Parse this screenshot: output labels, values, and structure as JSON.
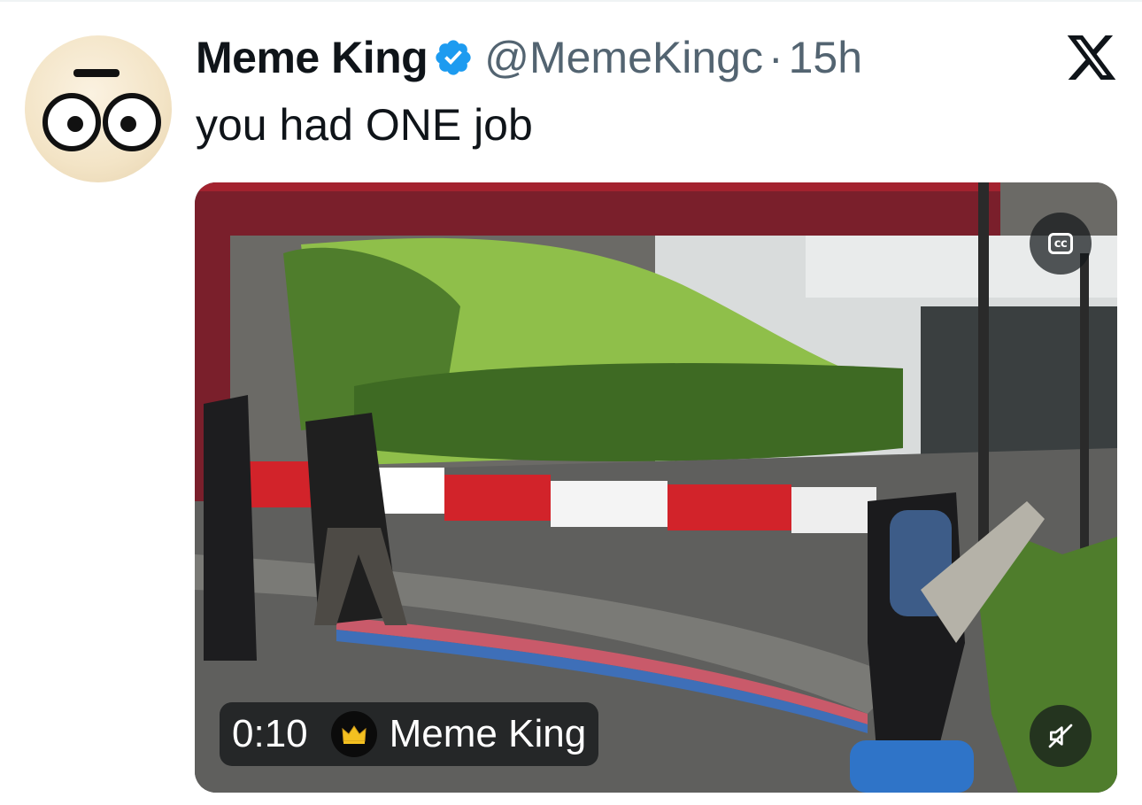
{
  "tweet": {
    "display_name": "Meme King",
    "handle": "@MemeKingc",
    "separator": "·",
    "time": "15h",
    "text": "you had ONE job",
    "verified": true
  },
  "icons": {
    "avatar": "wide-eyed-face-avatar",
    "verified": "verified-badge-icon",
    "platform": "x-logo-icon",
    "captions": "closed-captions-icon",
    "mute": "muted-speaker-icon",
    "source_badge": "crown-icon"
  },
  "video": {
    "duration": "0:10",
    "source_name": "Meme King",
    "captions_label": "cc"
  },
  "colors": {
    "verified_blue": "#1d9bf0",
    "text_primary": "#0f1419",
    "text_secondary": "#536471",
    "crown_gold": "#f4c020"
  }
}
